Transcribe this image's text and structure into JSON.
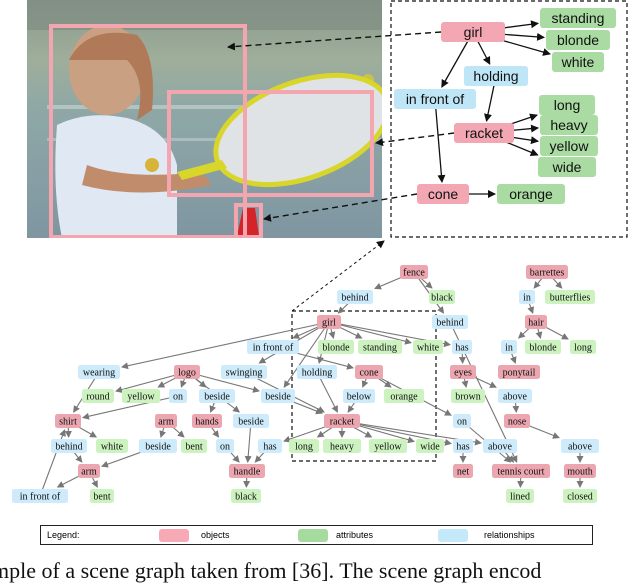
{
  "figure": {
    "photo": {
      "description": "girl holding a tennis racket near a cone",
      "boxes": [
        {
          "label": "girl",
          "color": "#f4a6b0"
        },
        {
          "label": "racket",
          "color": "#f4a6b0"
        },
        {
          "label": "cone",
          "color": "#f4a6b0"
        }
      ]
    },
    "colors": {
      "object": "#f2a7b3",
      "attribute": "#a9dba3",
      "relationship": "#bfe6f7",
      "object_small": "#eba6b0",
      "attribute_small": "#ccf2bf",
      "relationship_small": "#cdebfa",
      "edge": "#777777"
    },
    "zoom_graph": {
      "nodes": [
        {
          "id": "girl",
          "label": "girl",
          "type": "object"
        },
        {
          "id": "standing",
          "label": "standing",
          "type": "attribute"
        },
        {
          "id": "blonde",
          "label": "blonde",
          "type": "attribute"
        },
        {
          "id": "white",
          "label": "white",
          "type": "attribute"
        },
        {
          "id": "holding",
          "label": "holding",
          "type": "relationship"
        },
        {
          "id": "infrontof",
          "label": "in front of",
          "type": "relationship"
        },
        {
          "id": "racket",
          "label": "racket",
          "type": "object"
        },
        {
          "id": "long",
          "label": "long",
          "type": "attribute"
        },
        {
          "id": "heavy",
          "label": "heavy",
          "type": "attribute"
        },
        {
          "id": "yellow",
          "label": "yellow",
          "type": "attribute"
        },
        {
          "id": "wide",
          "label": "wide",
          "type": "attribute"
        },
        {
          "id": "cone",
          "label": "cone",
          "type": "object"
        },
        {
          "id": "orange",
          "label": "orange",
          "type": "attribute"
        }
      ]
    },
    "full_graph": {
      "nodes": [
        {
          "id": "fence",
          "label": "fence",
          "type": "object"
        },
        {
          "id": "behind1",
          "label": "behind",
          "type": "relationship"
        },
        {
          "id": "black1",
          "label": "black",
          "type": "attribute"
        },
        {
          "id": "barrettes",
          "label": "barrettes",
          "type": "object"
        },
        {
          "id": "in1",
          "label": "in",
          "type": "relationship"
        },
        {
          "id": "butterflies",
          "label": "butterflies",
          "type": "attribute"
        },
        {
          "id": "girl",
          "label": "girl",
          "type": "object"
        },
        {
          "id": "behind2",
          "label": "behind",
          "type": "relationship"
        },
        {
          "id": "hair",
          "label": "hair",
          "type": "object"
        },
        {
          "id": "infrontof1",
          "label": "in front of",
          "type": "relationship"
        },
        {
          "id": "blonde1",
          "label": "blonde",
          "type": "attribute"
        },
        {
          "id": "standing",
          "label": "standing",
          "type": "attribute"
        },
        {
          "id": "white1",
          "label": "white",
          "type": "attribute"
        },
        {
          "id": "has1",
          "label": "has",
          "type": "relationship"
        },
        {
          "id": "in2",
          "label": "in",
          "type": "relationship"
        },
        {
          "id": "blonde2",
          "label": "blonde",
          "type": "attribute"
        },
        {
          "id": "long2",
          "label": "long",
          "type": "attribute"
        },
        {
          "id": "ponytail",
          "label": "ponytail",
          "type": "object"
        },
        {
          "id": "wearing",
          "label": "wearing",
          "type": "relationship"
        },
        {
          "id": "logo",
          "label": "logo",
          "type": "object"
        },
        {
          "id": "swinging",
          "label": "swinging",
          "type": "relationship"
        },
        {
          "id": "holding",
          "label": "holding",
          "type": "relationship"
        },
        {
          "id": "cone",
          "label": "cone",
          "type": "object"
        },
        {
          "id": "eyes",
          "label": "eyes",
          "type": "object"
        },
        {
          "id": "round",
          "label": "round",
          "type": "attribute"
        },
        {
          "id": "yellow1",
          "label": "yellow",
          "type": "attribute"
        },
        {
          "id": "on1",
          "label": "on",
          "type": "relationship"
        },
        {
          "id": "beside1",
          "label": "beside",
          "type": "relationship"
        },
        {
          "id": "beside2",
          "label": "beside",
          "type": "relationship"
        },
        {
          "id": "below",
          "label": "below",
          "type": "relationship"
        },
        {
          "id": "orange",
          "label": "orange",
          "type": "attribute"
        },
        {
          "id": "brown",
          "label": "brown",
          "type": "attribute"
        },
        {
          "id": "above1",
          "label": "above",
          "type": "relationship"
        },
        {
          "id": "shirt",
          "label": "shirt",
          "type": "object"
        },
        {
          "id": "arm1",
          "label": "arm",
          "type": "object"
        },
        {
          "id": "hands",
          "label": "hands",
          "type": "object"
        },
        {
          "id": "beside3",
          "label": "beside",
          "type": "relationship"
        },
        {
          "id": "racket",
          "label": "racket",
          "type": "object"
        },
        {
          "id": "on2",
          "label": "on",
          "type": "relationship"
        },
        {
          "id": "nose",
          "label": "nose",
          "type": "object"
        },
        {
          "id": "behind3",
          "label": "behind",
          "type": "relationship"
        },
        {
          "id": "white2",
          "label": "white",
          "type": "attribute"
        },
        {
          "id": "beside4",
          "label": "beside",
          "type": "relationship"
        },
        {
          "id": "bent1",
          "label": "bent",
          "type": "attribute"
        },
        {
          "id": "on3",
          "label": "on",
          "type": "relationship"
        },
        {
          "id": "has2",
          "label": "has",
          "type": "relationship"
        },
        {
          "id": "long1",
          "label": "long",
          "type": "attribute"
        },
        {
          "id": "heavy",
          "label": "heavy",
          "type": "attribute"
        },
        {
          "id": "yellow2",
          "label": "yellow",
          "type": "attribute"
        },
        {
          "id": "wide",
          "label": "wide",
          "type": "attribute"
        },
        {
          "id": "has3",
          "label": "has",
          "type": "relationship"
        },
        {
          "id": "above2",
          "label": "above",
          "type": "relationship"
        },
        {
          "id": "above3",
          "label": "above",
          "type": "relationship"
        },
        {
          "id": "arm2",
          "label": "arm",
          "type": "object"
        },
        {
          "id": "handle",
          "label": "handle",
          "type": "object"
        },
        {
          "id": "net",
          "label": "net",
          "type": "object"
        },
        {
          "id": "tenniscourt",
          "label": "tennis court",
          "type": "object"
        },
        {
          "id": "mouth",
          "label": "mouth",
          "type": "object"
        },
        {
          "id": "infrontof2",
          "label": "in front of",
          "type": "relationship"
        },
        {
          "id": "bent2",
          "label": "bent",
          "type": "attribute"
        },
        {
          "id": "black2",
          "label": "black",
          "type": "attribute"
        },
        {
          "id": "lined",
          "label": "lined",
          "type": "attribute"
        },
        {
          "id": "closed",
          "label": "closed",
          "type": "attribute"
        }
      ]
    },
    "legend": {
      "title": "Legend:",
      "items": [
        {
          "label": "objects",
          "color": "#f7a9b5"
        },
        {
          "label": "attributes",
          "color": "#a6dba0"
        },
        {
          "label": "relationships",
          "color": "#c3e9fa"
        }
      ]
    },
    "caption": "mple of a scene graph taken from [36]. The scene graph encod"
  }
}
